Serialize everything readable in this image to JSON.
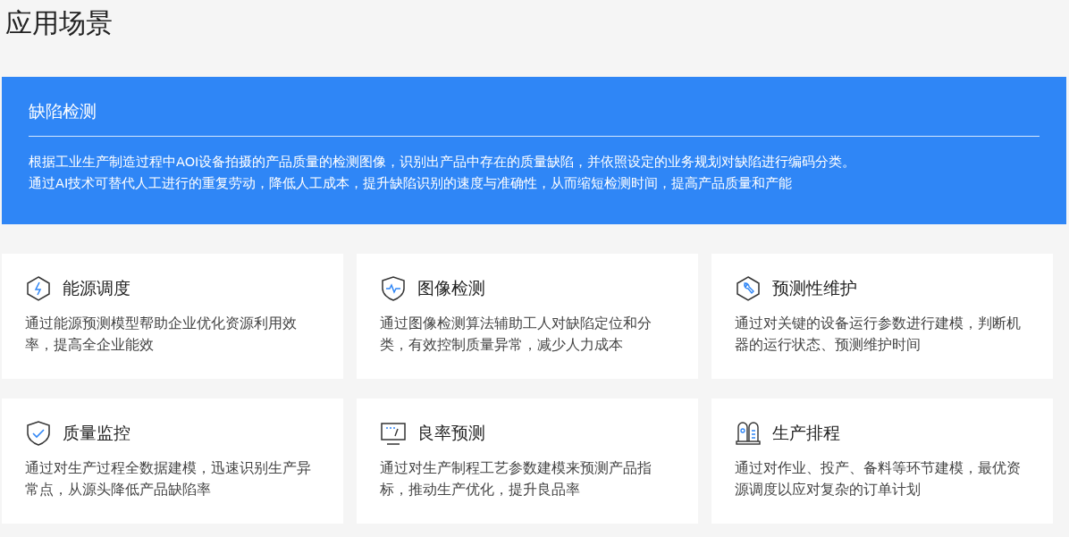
{
  "title": "应用场景",
  "banner": {
    "title": "缺陷检测",
    "lines": [
      "根据工业生产制造过程中AOI设备拍摄的产品质量的检测图像，识别出产品中存在的质量缺陷，并依照设定的业务规划对缺陷进行编码分类。",
      "通过AI技术可替代人工进行的重复劳动，降低人工成本，提升缺陷识别的速度与准确性，从而缩短检测时间，提高产品质量和产能"
    ]
  },
  "cards": [
    {
      "kind": "energy",
      "title": "能源调度",
      "text": "通过能源预测模型帮助企业优化资源利用效率，提高全企业能效"
    },
    {
      "kind": "pulse",
      "title": "图像检测",
      "text": "通过图像检测算法辅助工人对缺陷定位和分类，有效控制质量异常，减少人力成本"
    },
    {
      "kind": "wrench",
      "title": "预测性维护",
      "text": "通过对关键的设备运行参数进行建模，判断机器的运行状态、预测维护时间"
    },
    {
      "kind": "check",
      "title": "质量监控",
      "text": "通过对生产过程全数据建模，迅速识别生产异常点，从源头降低产品缺陷率"
    },
    {
      "kind": "screen",
      "title": "良率预测",
      "text": "通过对生产制程工艺参数建模来预测产品指标，推动生产优化，提升良品率"
    },
    {
      "kind": "machine",
      "title": "生产排程",
      "text": "通过对作业、投产、备料等环节建模，最优资源调度以应对复杂的订单计划"
    }
  ]
}
